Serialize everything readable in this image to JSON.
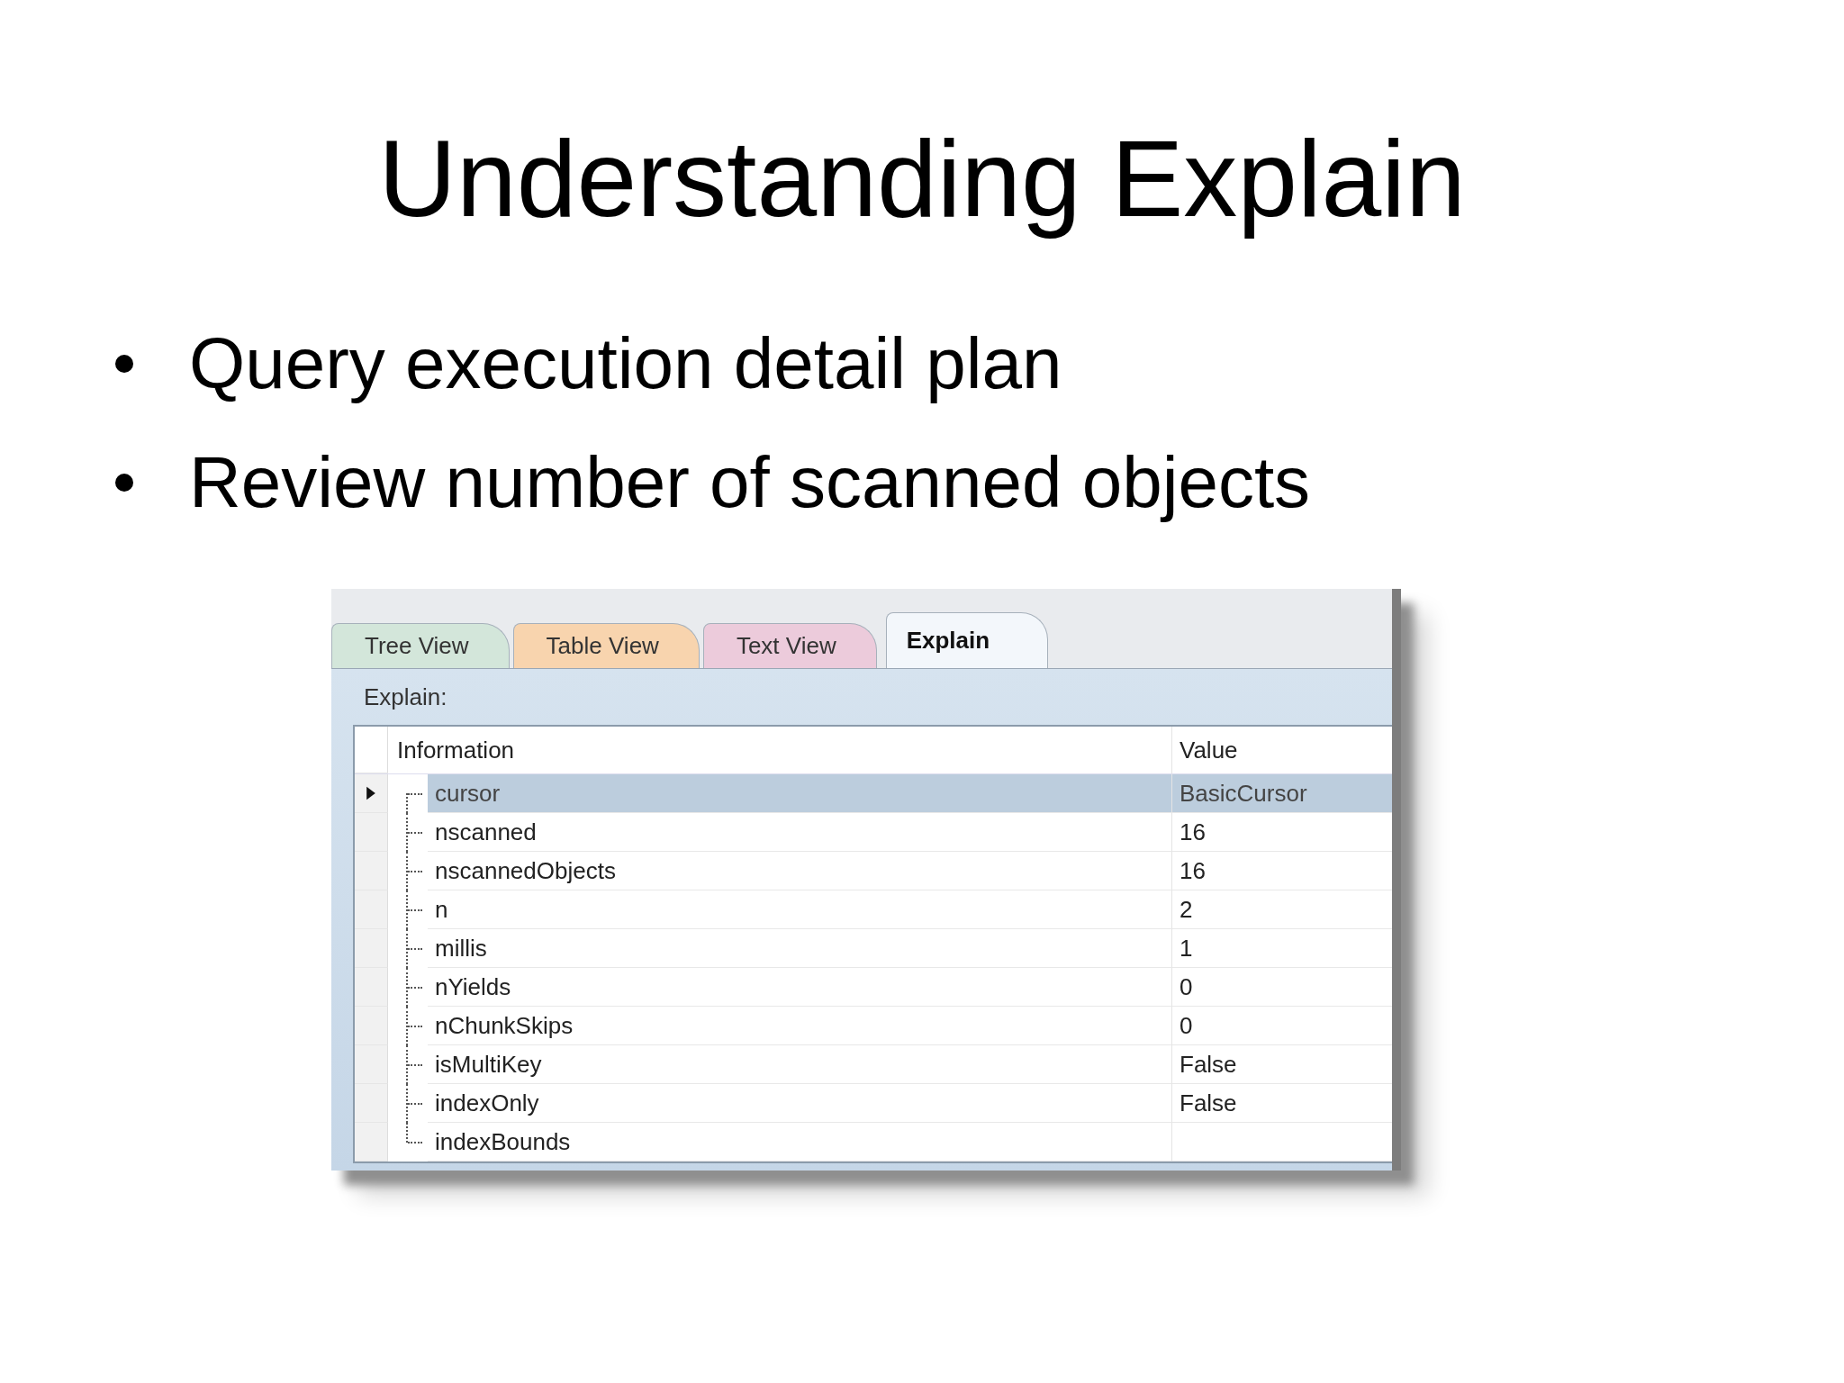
{
  "slide": {
    "title": "Understanding Explain",
    "bullets": [
      "Query execution detail plan",
      "Review number of scanned objects"
    ]
  },
  "window": {
    "tabs": [
      {
        "label": "Tree View",
        "selected": false,
        "color": "#d3e6da"
      },
      {
        "label": "Table View",
        "selected": false,
        "color": "#f8d4ae"
      },
      {
        "label": "Text View",
        "selected": false,
        "color": "#eccbdb"
      },
      {
        "label": "Explain",
        "selected": true,
        "color": "#f3f7fb"
      }
    ],
    "panel_label": "Explain:",
    "table": {
      "columns": [
        "Information",
        "Value"
      ],
      "rows": [
        {
          "name": "cursor",
          "value": "BasicCursor",
          "selected": true
        },
        {
          "name": "nscanned",
          "value": "16",
          "selected": false
        },
        {
          "name": "nscannedObjects",
          "value": "16",
          "selected": false
        },
        {
          "name": "n",
          "value": "2",
          "selected": false
        },
        {
          "name": "millis",
          "value": "1",
          "selected": false
        },
        {
          "name": "nYields",
          "value": "0",
          "selected": false
        },
        {
          "name": "nChunkSkips",
          "value": "0",
          "selected": false
        },
        {
          "name": "isMultiKey",
          "value": "False",
          "selected": false
        },
        {
          "name": "indexOnly",
          "value": "False",
          "selected": false
        },
        {
          "name": "indexBounds",
          "value": "",
          "selected": false
        }
      ]
    }
  }
}
